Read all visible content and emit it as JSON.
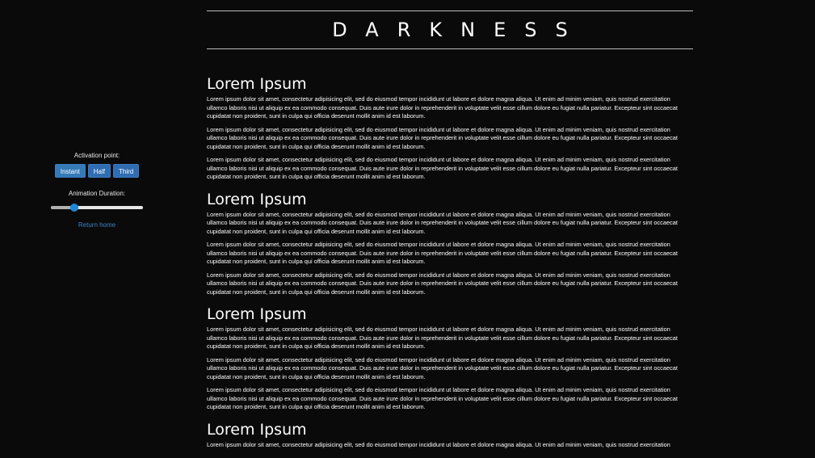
{
  "header": {
    "title": "DARKNESS"
  },
  "sidebar": {
    "activation_label": "Activation point:",
    "buttons": [
      {
        "label": "Instant"
      },
      {
        "label": "Half"
      },
      {
        "label": "Third"
      }
    ],
    "duration_label": "Animation Duration:",
    "slider_fraction": 0.25,
    "return_link": "Return home"
  },
  "sections": [
    {
      "heading": "Lorem Ipsum",
      "paragraphs": [
        "Lorem ipsum dolor sit amet, consectetur adipisicing elit, sed do eiusmod tempor incididunt ut labore et dolore magna aliqua. Ut enim ad minim veniam, quis nostrud exercitation ullamco laboris nisi ut aliquip ex ea commodo consequat. Duis aute irure dolor in reprehenderit in voluptate velit esse cillum dolore eu fugiat nulla pariatur. Excepteur sint occaecat cupidatat non proident, sunt in culpa qui officia deserunt mollit anim id est laborum.",
        "Lorem ipsum dolor sit amet, consectetur adipisicing elit, sed do eiusmod tempor incididunt ut labore et dolore magna aliqua. Ut enim ad minim veniam, quis nostrud exercitation ullamco laboris nisi ut aliquip ex ea commodo consequat. Duis aute irure dolor in reprehenderit in voluptate velit esse cillum dolore eu fugiat nulla pariatur. Excepteur sint occaecat cupidatat non proident, sunt in culpa qui officia deserunt mollit anim id est laborum.",
        "Lorem ipsum dolor sit amet, consectetur adipisicing elit, sed do eiusmod tempor incididunt ut labore et dolore magna aliqua. Ut enim ad minim veniam, quis nostrud exercitation ullamco laboris nisi ut aliquip ex ea commodo consequat. Duis aute irure dolor in reprehenderit in voluptate velit esse cillum dolore eu fugiat nulla pariatur. Excepteur sint occaecat cupidatat non proident, sunt in culpa qui officia deserunt mollit anim id est laborum."
      ]
    },
    {
      "heading": "Lorem Ipsum",
      "paragraphs": [
        "Lorem ipsum dolor sit amet, consectetur adipisicing elit, sed do eiusmod tempor incididunt ut labore et dolore magna aliqua. Ut enim ad minim veniam, quis nostrud exercitation ullamco laboris nisi ut aliquip ex ea commodo consequat. Duis aute irure dolor in reprehenderit in voluptate velit esse cillum dolore eu fugiat nulla pariatur. Excepteur sint occaecat cupidatat non proident, sunt in culpa qui officia deserunt mollit anim id est laborum.",
        "Lorem ipsum dolor sit amet, consectetur adipisicing elit, sed do eiusmod tempor incididunt ut labore et dolore magna aliqua. Ut enim ad minim veniam, quis nostrud exercitation ullamco laboris nisi ut aliquip ex ea commodo consequat. Duis aute irure dolor in reprehenderit in voluptate velit esse cillum dolore eu fugiat nulla pariatur. Excepteur sint occaecat cupidatat non proident, sunt in culpa qui officia deserunt mollit anim id est laborum.",
        "Lorem ipsum dolor sit amet, consectetur adipisicing elit, sed do eiusmod tempor incididunt ut labore et dolore magna aliqua. Ut enim ad minim veniam, quis nostrud exercitation ullamco laboris nisi ut aliquip ex ea commodo consequat. Duis aute irure dolor in reprehenderit in voluptate velit esse cillum dolore eu fugiat nulla pariatur. Excepteur sint occaecat cupidatat non proident, sunt in culpa qui officia deserunt mollit anim id est laborum."
      ]
    },
    {
      "heading": "Lorem Ipsum",
      "paragraphs": [
        "Lorem ipsum dolor sit amet, consectetur adipisicing elit, sed do eiusmod tempor incididunt ut labore et dolore magna aliqua. Ut enim ad minim veniam, quis nostrud exercitation ullamco laboris nisi ut aliquip ex ea commodo consequat. Duis aute irure dolor in reprehenderit in voluptate velit esse cillum dolore eu fugiat nulla pariatur. Excepteur sint occaecat cupidatat non proident, sunt in culpa qui officia deserunt mollit anim id est laborum.",
        "Lorem ipsum dolor sit amet, consectetur adipisicing elit, sed do eiusmod tempor incididunt ut labore et dolore magna aliqua. Ut enim ad minim veniam, quis nostrud exercitation ullamco laboris nisi ut aliquip ex ea commodo consequat. Duis aute irure dolor in reprehenderit in voluptate velit esse cillum dolore eu fugiat nulla pariatur. Excepteur sint occaecat cupidatat non proident, sunt in culpa qui officia deserunt mollit anim id est laborum.",
        "Lorem ipsum dolor sit amet, consectetur adipisicing elit, sed do eiusmod tempor incididunt ut labore et dolore magna aliqua. Ut enim ad minim veniam, quis nostrud exercitation ullamco laboris nisi ut aliquip ex ea commodo consequat. Duis aute irure dolor in reprehenderit in voluptate velit esse cillum dolore eu fugiat nulla pariatur. Excepteur sint occaecat cupidatat non proident, sunt in culpa qui officia deserunt mollit anim id est laborum."
      ]
    },
    {
      "heading": "Lorem Ipsum",
      "paragraphs": [
        "Lorem ipsum dolor sit amet, consectetur adipisicing elit, sed do eiusmod tempor incididunt ut labore et dolore magna aliqua. Ut enim ad minim veniam, quis nostrud exercitation"
      ]
    }
  ]
}
